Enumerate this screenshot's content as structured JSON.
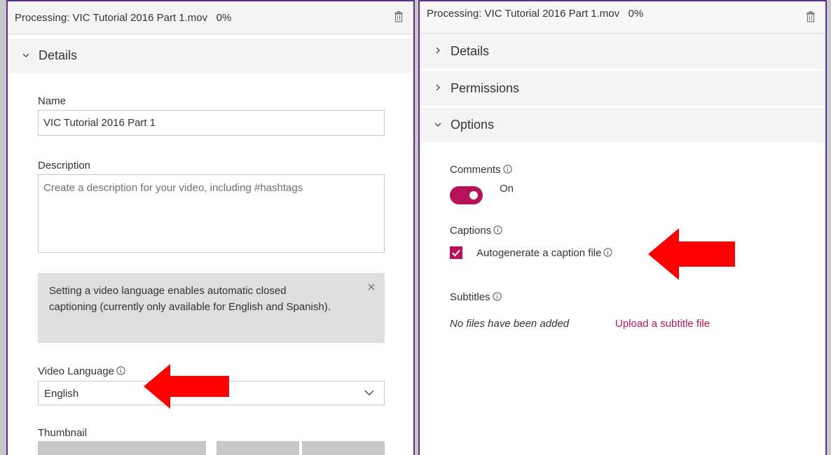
{
  "colors": {
    "accent": "#b4135a",
    "panel_border": "#5c2d91",
    "arrow": "#ff0000"
  },
  "left_panel": {
    "header": {
      "title": "Processing: VIC Tutorial 2016 Part 1.mov   0%",
      "icon": "trash-icon"
    },
    "details_section": {
      "label": "Details",
      "state": "expanded"
    },
    "name": {
      "label": "Name",
      "value": "VIC Tutorial 2016 Part 1"
    },
    "description": {
      "label": "Description",
      "placeholder": "Create a description for your video, including #hashtags"
    },
    "notice": {
      "text": "Setting a video language enables automatic closed captioning (currently only available for English and Spanish).",
      "icon": "close-icon"
    },
    "video_language": {
      "label": "Video Language",
      "selected": "English"
    },
    "thumbnail": {
      "label": "Thumbnail"
    }
  },
  "right_panel": {
    "header": {
      "title": "Processing: VIC Tutorial 2016 Part 1.mov   0%",
      "icon": "trash-icon"
    },
    "sections": [
      {
        "label": "Details",
        "state": "collapsed"
      },
      {
        "label": "Permissions",
        "state": "collapsed"
      },
      {
        "label": "Options",
        "state": "expanded"
      }
    ],
    "comments": {
      "label": "Comments",
      "toggle_label": "On",
      "enabled": true
    },
    "captions": {
      "label": "Captions",
      "checkbox_label": "Autogenerate a caption file",
      "checked": true
    },
    "subtitles": {
      "label": "Subtitles",
      "empty_text": "No files have been added",
      "upload_link": "Upload a subtitle file"
    }
  }
}
